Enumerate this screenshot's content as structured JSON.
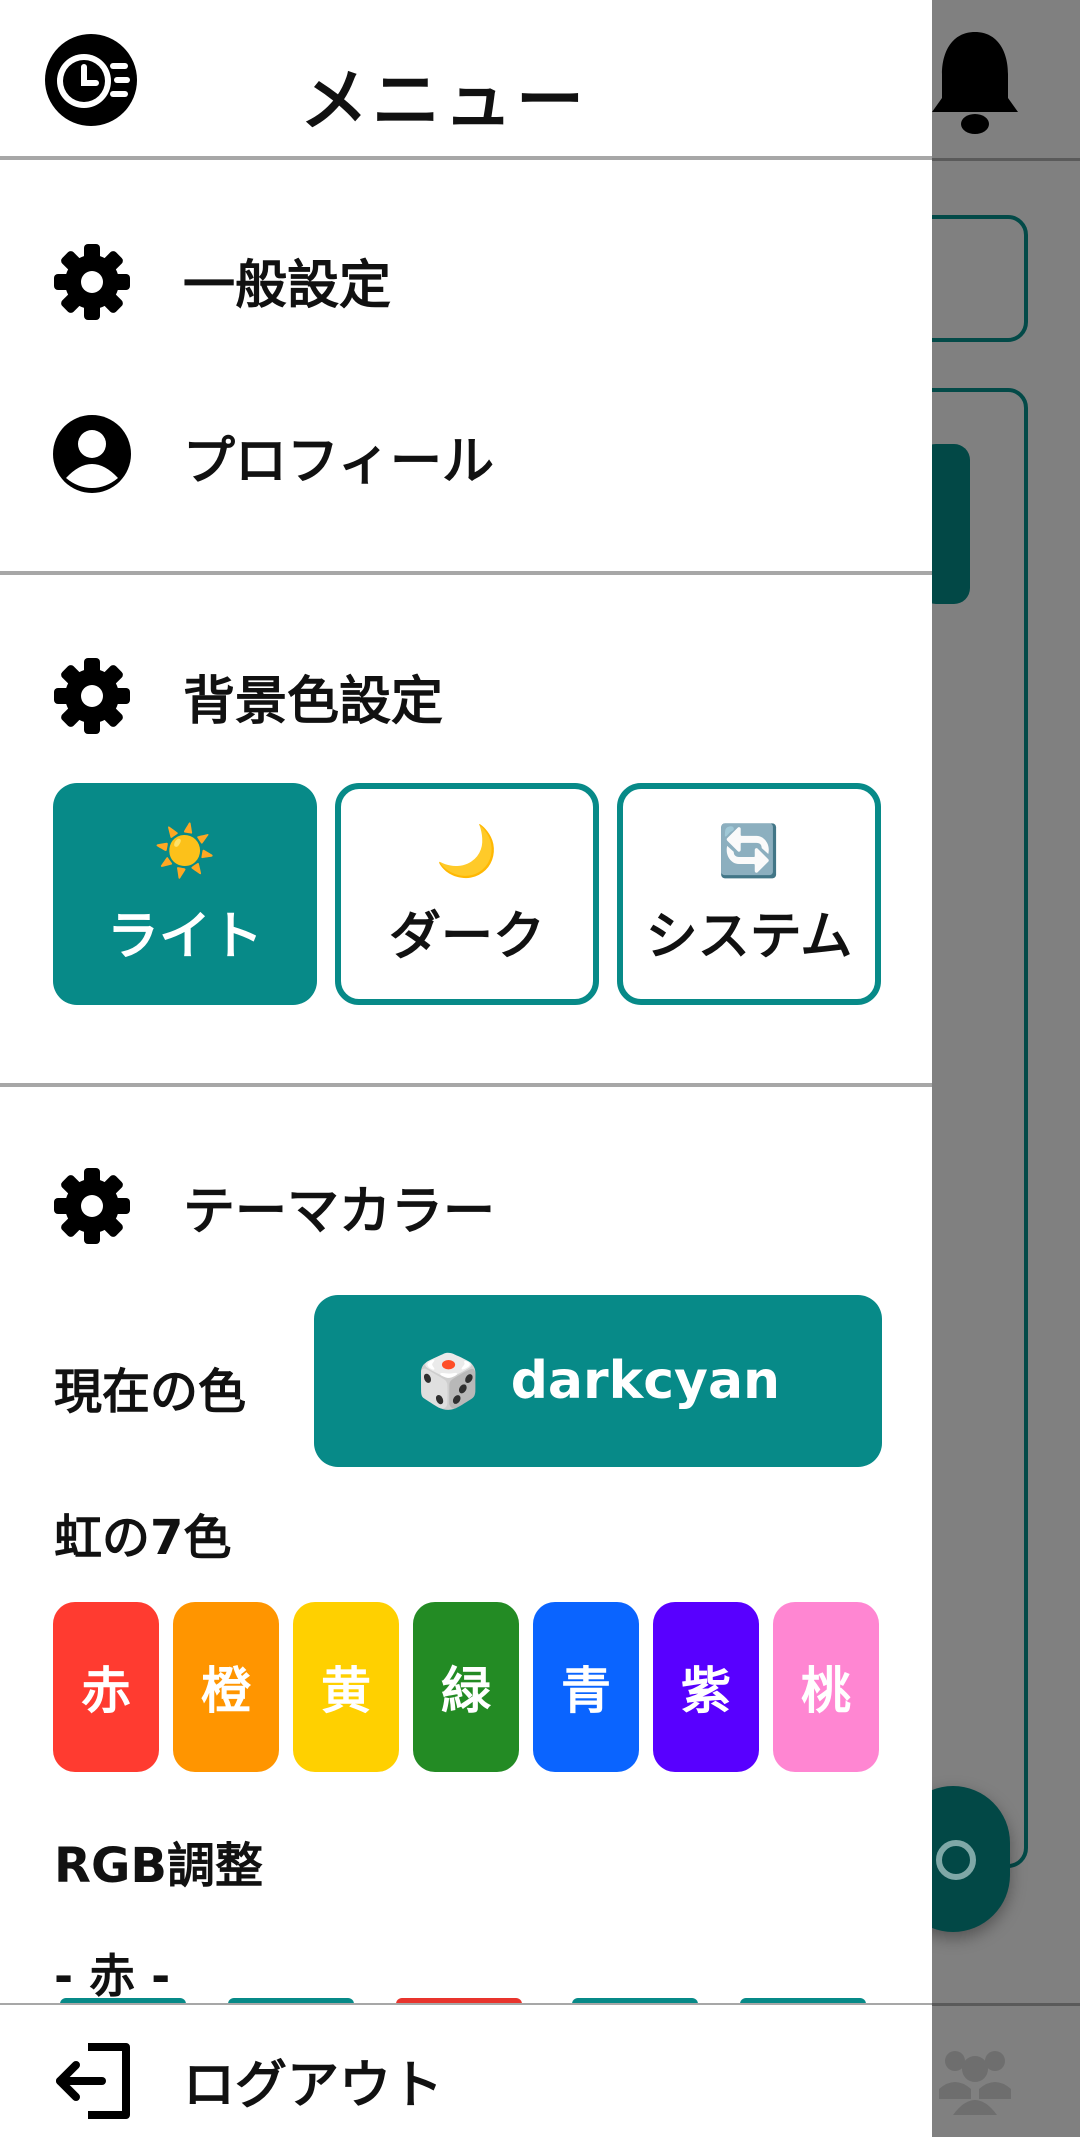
{
  "drawer": {
    "title": "メニュー",
    "logo_icon": "clock-speed-logo-icon"
  },
  "menu": {
    "general_settings": {
      "label": "一般設定",
      "icon": "gear-icon"
    },
    "profile": {
      "label": "プロフィール",
      "icon": "user-circle-icon"
    }
  },
  "background_color": {
    "heading": "背景色設定",
    "icon": "gear-icon",
    "modes": [
      {
        "emoji": "☀️",
        "label": "ライト",
        "selected": true
      },
      {
        "emoji": "🌙",
        "label": "ダーク",
        "selected": false
      },
      {
        "emoji": "🔄",
        "label": "システム",
        "selected": false
      }
    ]
  },
  "theme_color": {
    "heading": "テーマカラー",
    "icon": "gear-icon",
    "current_label": "現在の色",
    "current_value": "darkcyan",
    "current_emoji": "🎲",
    "accent": "#078a88",
    "rainbow_label": "虹の7色",
    "swatches": [
      {
        "label": "赤",
        "color": "#ff3b30"
      },
      {
        "label": "橙",
        "color": "#ff9500"
      },
      {
        "label": "黄",
        "color": "#ffd000"
      },
      {
        "label": "緑",
        "color": "#238b24"
      },
      {
        "label": "青",
        "color": "#0a64ff"
      },
      {
        "label": "紫",
        "color": "#5800ff"
      },
      {
        "label": "桃",
        "color": "#ff86d2"
      }
    ],
    "rgb_label": "RGB調整",
    "red_label": "- 赤 -"
  },
  "logout": {
    "label": "ログアウト",
    "icon": "logout-icon"
  },
  "background_screen": {
    "bell_icon": "bell-icon",
    "bottom_nav_icon": "group-icon"
  }
}
